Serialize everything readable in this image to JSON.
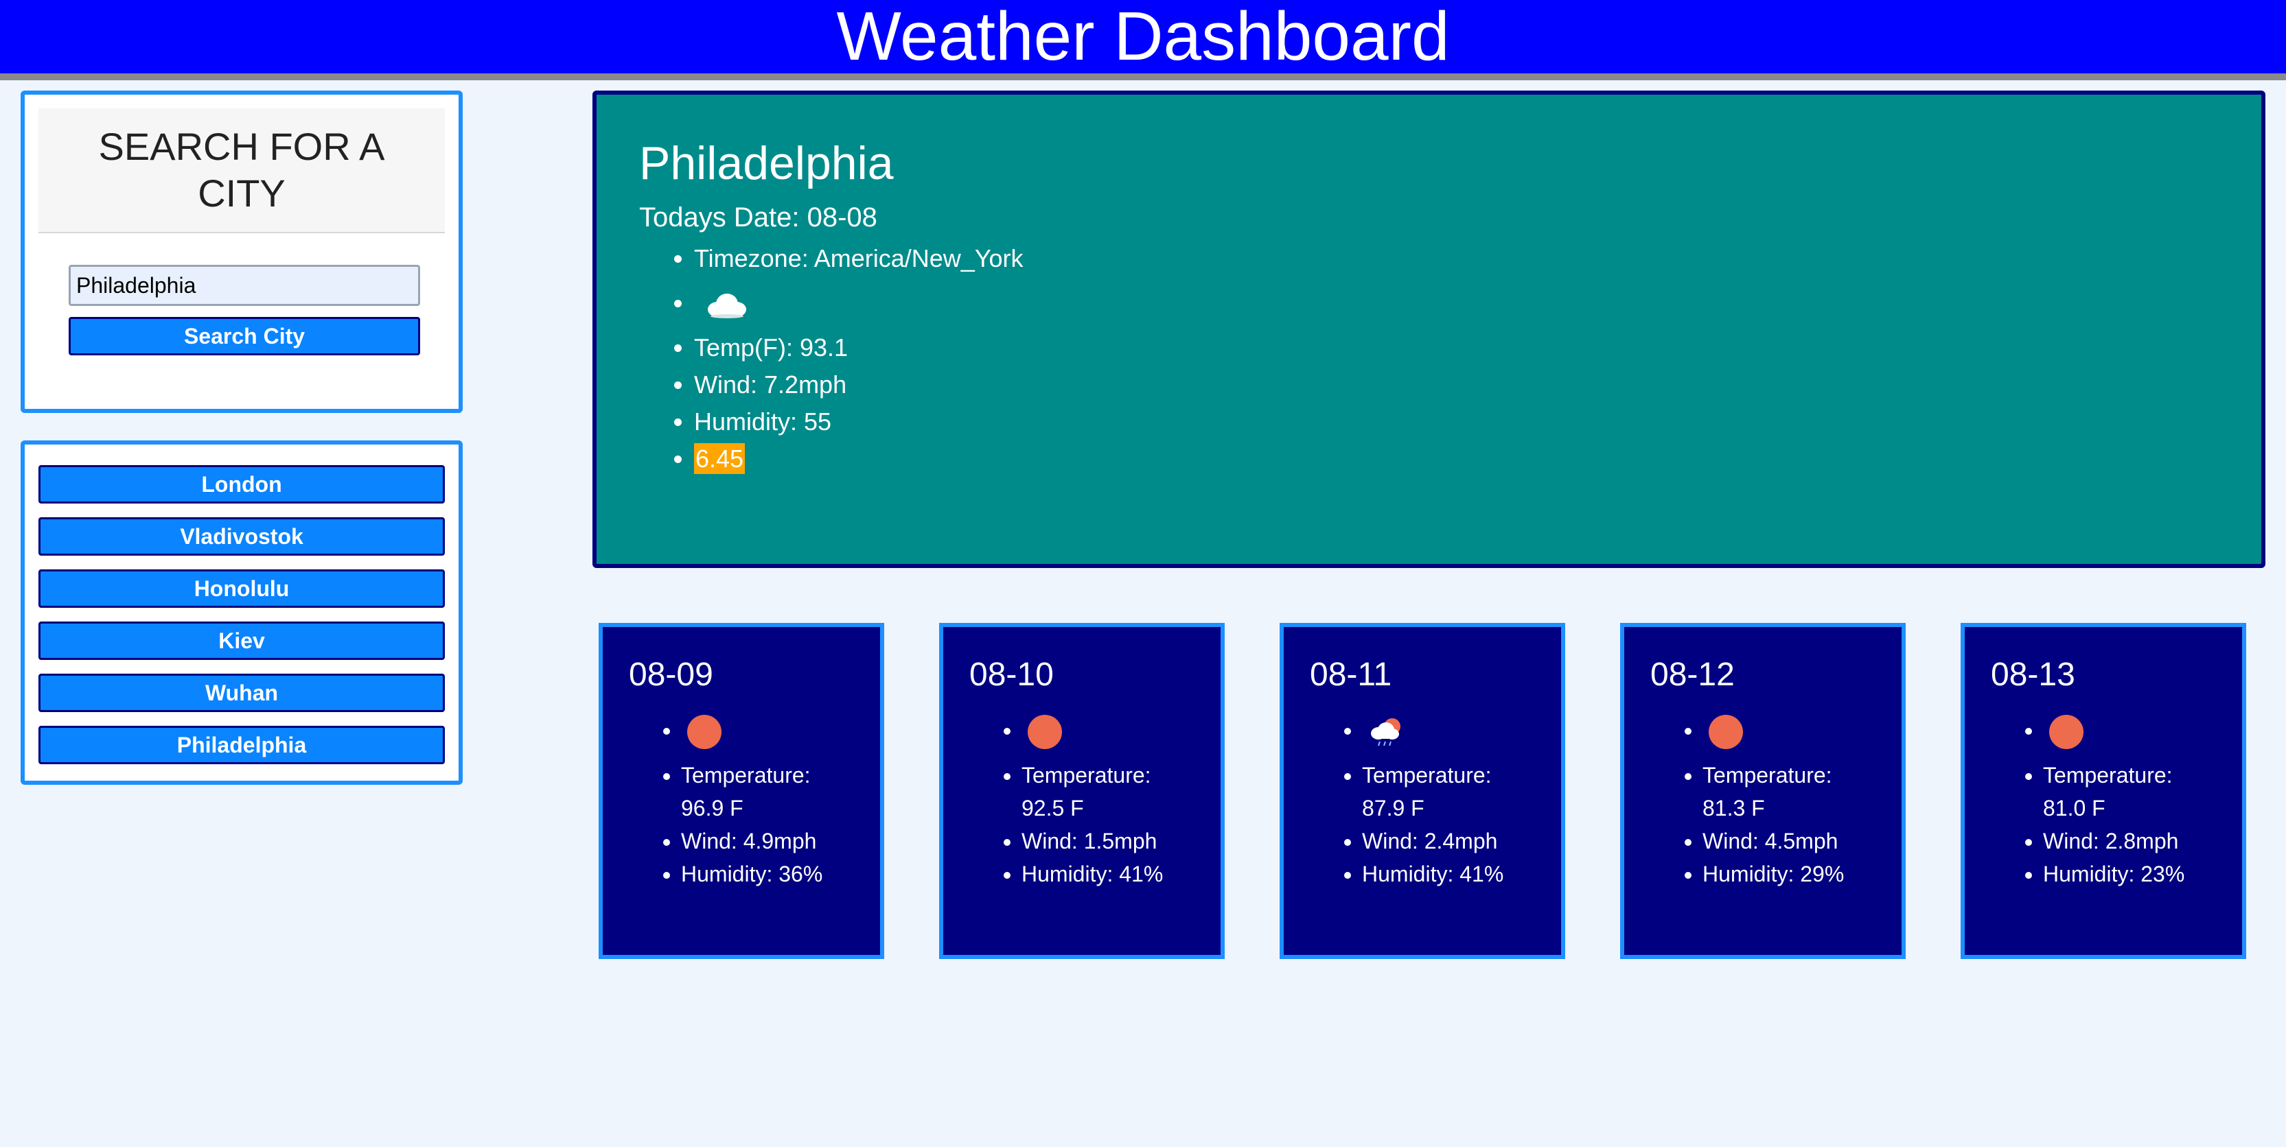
{
  "header": {
    "title": "Weather Dashboard"
  },
  "search": {
    "heading": "SEARCH FOR A CITY",
    "input_value": "Philadelphia",
    "button_label": "Search City"
  },
  "history": {
    "cities": [
      "London",
      "Vladivostok",
      "Honolulu",
      "Kiev",
      "Wuhan",
      "Philadelphia"
    ]
  },
  "current": {
    "city": "Philadelphia",
    "date_text": "Todays Date: 08-08",
    "timezone_text": "Timezone: America/New_York",
    "icon": "cloud-icon",
    "temp_text": "Temp(F): 93.1",
    "wind_text": "Wind: 7.2mph",
    "humidity_text": "Humidity: 55",
    "uv_value": "6.45",
    "uv_color": "#ffa500"
  },
  "forecast": [
    {
      "date": "08-09",
      "icon": "sun-icon",
      "temperature": "Temperature: 96.9 F",
      "wind": "Wind: 4.9mph",
      "humidity": "Humidity: 36%"
    },
    {
      "date": "08-10",
      "icon": "sun-icon",
      "temperature": "Temperature: 92.5 F",
      "wind": "Wind: 1.5mph",
      "humidity": "Humidity: 41%"
    },
    {
      "date": "08-11",
      "icon": "rain-cloud-sun-icon",
      "temperature": "Temperature: 87.9 F",
      "wind": "Wind: 2.4mph",
      "humidity": "Humidity: 41%"
    },
    {
      "date": "08-12",
      "icon": "sun-icon",
      "temperature": "Temperature: 81.3 F",
      "wind": "Wind: 4.5mph",
      "humidity": "Humidity: 29%"
    },
    {
      "date": "08-13",
      "icon": "sun-icon",
      "temperature": "Temperature: 81.0 F",
      "wind": "Wind: 2.8mph",
      "humidity": "Humidity: 23%"
    }
  ],
  "colors": {
    "header_bg": "#0000ff",
    "current_bg": "#008b8b",
    "forecast_bg": "#000080",
    "button_bg": "#0a84ff",
    "card_border": "#1e8fff"
  }
}
